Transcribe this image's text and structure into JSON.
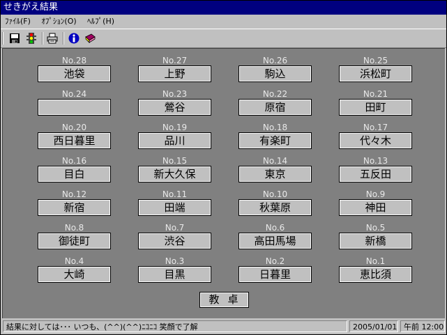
{
  "window": {
    "title": "せきがえ結果"
  },
  "menu": [
    {
      "label": "ﾌｧｲﾙ(F)"
    },
    {
      "label": "ｵﾌﾟｼｮﾝ(O)"
    },
    {
      "label": "ﾍﾙﾌﾟ(H)"
    }
  ],
  "toolbar": {
    "buttons": [
      {
        "name": "save-icon"
      },
      {
        "name": "traffic-light-icon"
      },
      {
        "name": "print-icon"
      },
      {
        "name": "info-icon"
      },
      {
        "name": "help-book-icon"
      }
    ]
  },
  "seats": [
    {
      "no": "No.28",
      "name": "池袋"
    },
    {
      "no": "No.27",
      "name": "上野"
    },
    {
      "no": "No.26",
      "name": "駒込"
    },
    {
      "no": "No.25",
      "name": "浜松町"
    },
    {
      "no": "No.24",
      "name": ""
    },
    {
      "no": "No.23",
      "name": "鶯谷"
    },
    {
      "no": "No.22",
      "name": "原宿"
    },
    {
      "no": "No.21",
      "name": "田町"
    },
    {
      "no": "No.20",
      "name": "西日暮里"
    },
    {
      "no": "No.19",
      "name": "品川"
    },
    {
      "no": "No.18",
      "name": "有楽町"
    },
    {
      "no": "No.17",
      "name": "代々木"
    },
    {
      "no": "No.16",
      "name": "目白"
    },
    {
      "no": "No.15",
      "name": "新大久保"
    },
    {
      "no": "No.14",
      "name": "東京"
    },
    {
      "no": "No.13",
      "name": "五反田"
    },
    {
      "no": "No.12",
      "name": "新宿"
    },
    {
      "no": "No.11",
      "name": "田端"
    },
    {
      "no": "No.10",
      "name": "秋葉原"
    },
    {
      "no": "No.9",
      "name": "神田"
    },
    {
      "no": "No.8",
      "name": "御徒町"
    },
    {
      "no": "No.7",
      "name": "渋谷"
    },
    {
      "no": "No.6",
      "name": "高田馬場"
    },
    {
      "no": "No.5",
      "name": "新橋"
    },
    {
      "no": "No.4",
      "name": "大崎"
    },
    {
      "no": "No.3",
      "name": "目黒"
    },
    {
      "no": "No.2",
      "name": "日暮里"
    },
    {
      "no": "No.1",
      "name": "恵比須"
    }
  ],
  "desk": "教卓",
  "status": {
    "message": "結果に対しては･･･ いつも、(^^)(^^)ﾆｺﾆｺ 笑顔で了解",
    "date": "2005/01/01",
    "time": "午前 12:00"
  },
  "colors": {
    "titlebar": "#00007f",
    "room": "#808080",
    "panel": "#c0c0c0"
  }
}
